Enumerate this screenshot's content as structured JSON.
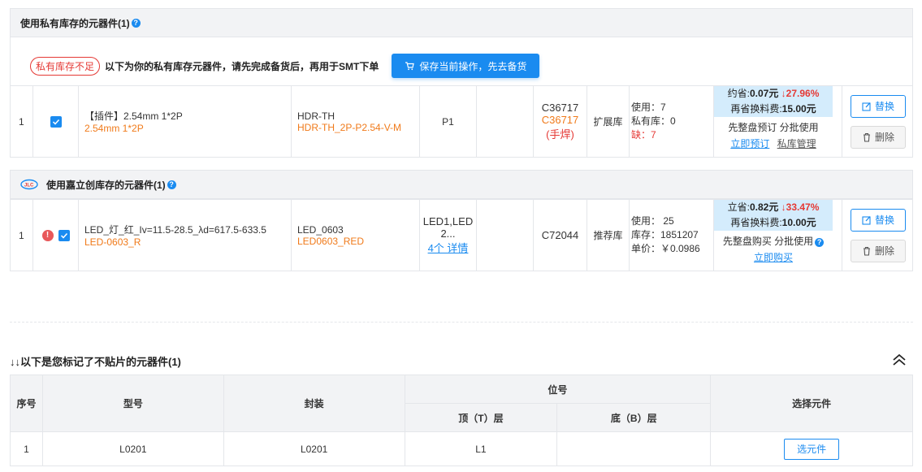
{
  "private": {
    "title": "使用私有库存的元器件(1)",
    "warning_pill": "私有库存不足",
    "warning_text": "以下为你的私有库存元器件，请先完成备货后，再用于SMT下单",
    "save_button": "保存当前操作，先去备货",
    "row": {
      "index": "1",
      "name": "【插件】2.54mm 1*2P",
      "name_sub": "2.54mm 1*2P",
      "package": "HDR-TH",
      "package_sub": "HDR-TH_2P-P2.54-V-M",
      "designator": "P1",
      "code": "C36717",
      "code_sub": "C36717",
      "code_note": "(手焊)",
      "lib_type": "扩展库",
      "use": "使用：7",
      "private_stock": "私有库：0",
      "short": "缺：7",
      "save_prefix": "约省:",
      "save_amount": "0.07元",
      "save_pct": "↓27.96%",
      "fee_label": "再省换料费:",
      "fee_amount": "15.00元",
      "buy_note": "先整盘预订 分批使用",
      "action_link": "立即预订",
      "manage_link": "私库管理",
      "replace_btn": "替换",
      "delete_btn": "删除"
    }
  },
  "jlc": {
    "title": "使用嘉立创库存的元器件(1)",
    "row": {
      "index": "1",
      "name": "LED_灯_红_Iv=11.5-28.5_λd=617.5-633.5",
      "name_sub": "LED-0603_R",
      "package": "LED_0603",
      "package_sub": "LED0603_RED",
      "designator_line1": "LED1,LED",
      "designator_line2": "2...",
      "designator_link": "4个 详情",
      "code": "C72044",
      "lib_type": "推荐库",
      "use": "使用：  25",
      "stock": "库存：1851207",
      "price": "单价：￥0.0986",
      "save_prefix": "立省:",
      "save_amount": "0.82元",
      "save_pct": "↓33.47%",
      "fee_label": "再省换料费:",
      "fee_amount": "10.00元",
      "buy_note": "先整盘购买 分批使用",
      "action_link": "立即购买",
      "replace_btn": "替换",
      "delete_btn": "删除"
    }
  },
  "no_place": {
    "title": "↓↓以下是您标记了不贴片的元器件(1)",
    "headers": {
      "index": "序号",
      "model": "型号",
      "package": "封装",
      "designator": "位号",
      "top": "顶（T）层",
      "bottom": "底（B）层",
      "select": "选择元件"
    },
    "row": {
      "index": "1",
      "model": "L0201",
      "package": "L0201",
      "top": "L1",
      "bottom": "",
      "select_btn": "选元件"
    }
  },
  "colors": {
    "accent": "#1a8bf0",
    "warn": "#e53935",
    "orange": "#f07a1a"
  }
}
